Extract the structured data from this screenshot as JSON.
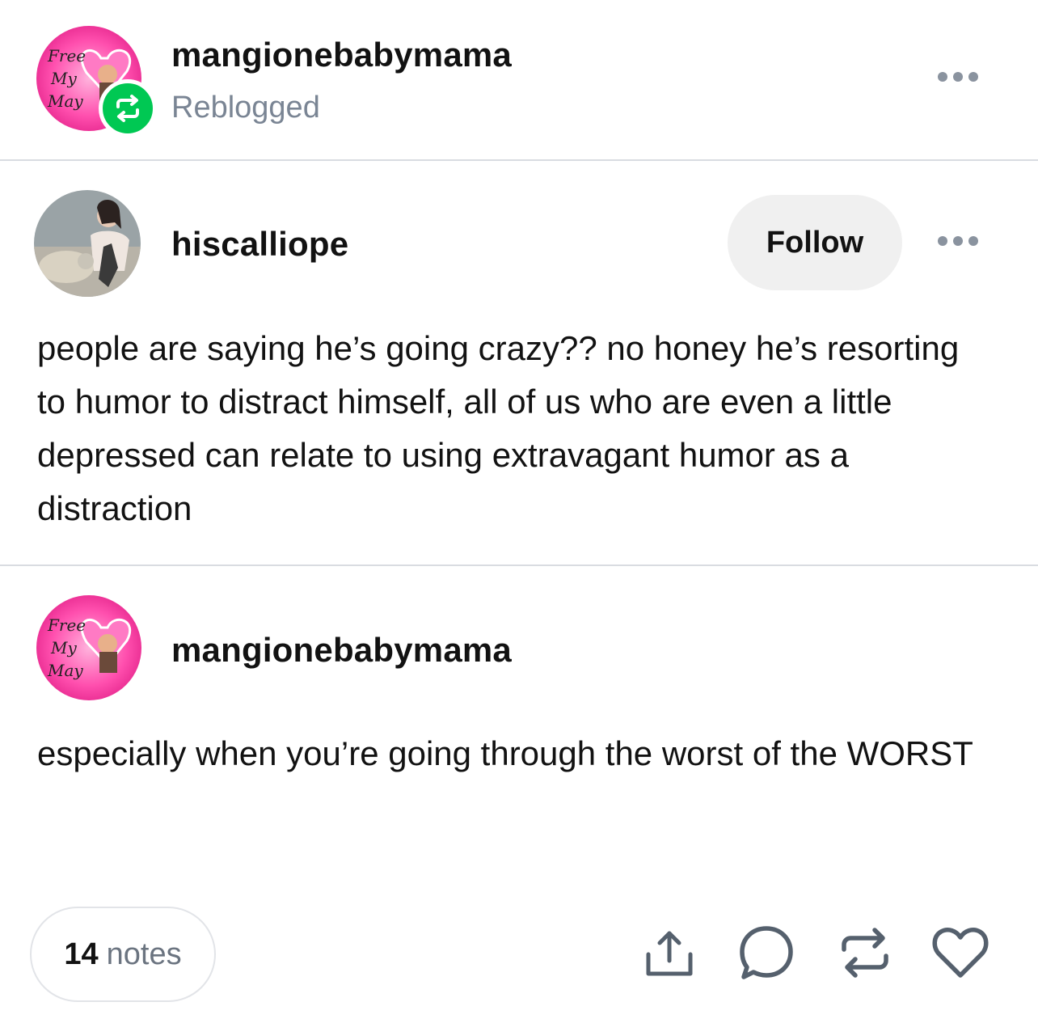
{
  "reblog_header": {
    "username": "mangionebabymama",
    "status": "Reblogged",
    "avatar_text": "Free My May"
  },
  "original_post": {
    "username": "hiscalliope",
    "follow_label": "Follow",
    "text": "people are saying he’s going crazy?? no honey he’s resorting to humor to distract himself, all of us who are even a little depressed can relate to using extravagant humor as a distraction"
  },
  "reply_post": {
    "username": "mangionebabymama",
    "avatar_text": "Free My May",
    "text": "especially when you’re going through the worst of the WORST"
  },
  "footer": {
    "notes_count": "14",
    "notes_label": "notes",
    "actions": [
      "share-icon",
      "comment-icon",
      "reblog-icon",
      "heart-icon"
    ]
  },
  "colors": {
    "reblog_green": "#00c853",
    "divider": "#d9dce1",
    "muted_text": "#7a8594",
    "avatar_pink": "#ff3fa4"
  }
}
